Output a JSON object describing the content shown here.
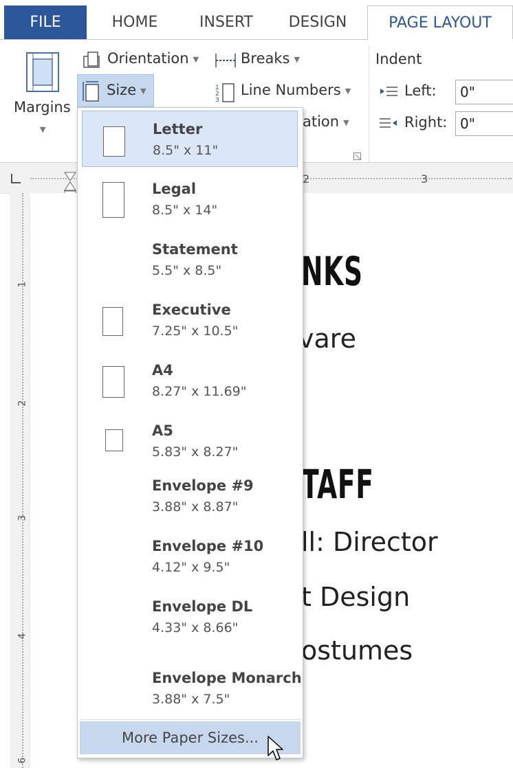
{
  "tabs": {
    "file": "FILE",
    "home": "HOME",
    "insert": "INSERT",
    "design": "DESIGN",
    "page_layout": "PAGE LAYOUT"
  },
  "ribbon": {
    "margins": "Margins",
    "orientation": "Orientation",
    "size": "Size",
    "breaks": "Breaks",
    "line_numbers": "Line Numbers",
    "hyphenation_partial": "ation",
    "indent_title": "Indent",
    "indent_left_label": "Left:",
    "indent_right_label": "Right:",
    "indent_left_value": "0\"",
    "indent_right_value": "0\""
  },
  "ruler": {
    "marks": [
      "2",
      "3"
    ],
    "vmarks": [
      "1",
      "2",
      "3",
      "4",
      "6"
    ]
  },
  "document": {
    "line1": "NKS",
    "line2": "vare",
    "line3": "TAFF",
    "line4": "ll: Director",
    "line5": "t Design",
    "line6": "ostumes"
  },
  "size_menu": {
    "items": [
      {
        "name": "Letter",
        "size": "8.5\" x 11\""
      },
      {
        "name": "Legal",
        "size": "8.5\" x 14\""
      },
      {
        "name": "Statement",
        "size": "5.5\" x 8.5\""
      },
      {
        "name": "Executive",
        "size": "7.25\" x 10.5\""
      },
      {
        "name": "A4",
        "size": "8.27\" x 11.69\""
      },
      {
        "name": "A5",
        "size": "5.83\" x 8.27\""
      },
      {
        "name": "Envelope #9",
        "size": "3.88\" x 8.87\""
      },
      {
        "name": "Envelope #10",
        "size": "4.12\" x 9.5\""
      },
      {
        "name": "Envelope DL",
        "size": "4.33\" x 8.66\""
      },
      {
        "name": "Envelope Monarch",
        "size": "3.88\" x 7.5\""
      }
    ],
    "more": "More Paper Sizes..."
  },
  "colors": {
    "accent": "#2b579a",
    "selected_bg": "#dbe7f6",
    "hover_bg": "#c7d8ee"
  }
}
